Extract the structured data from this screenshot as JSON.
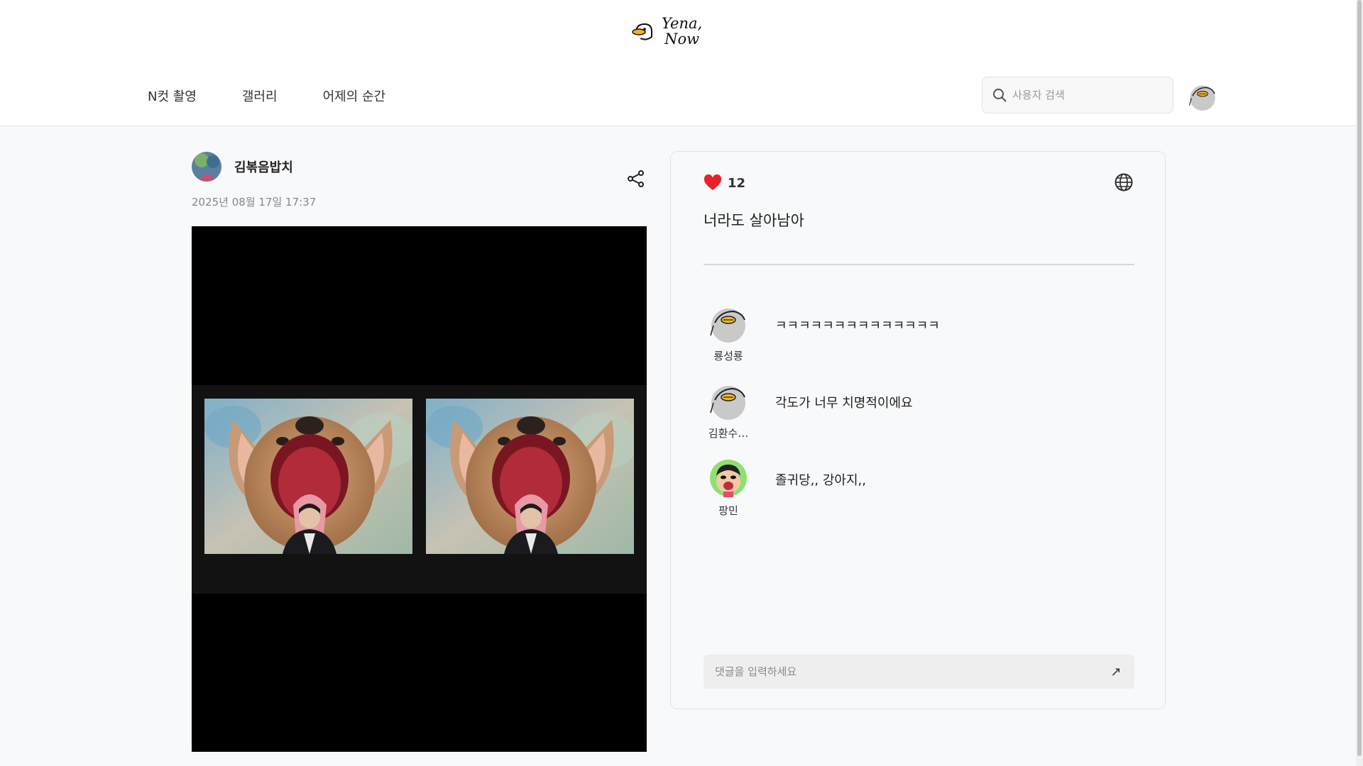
{
  "header": {
    "logo_line1": "Yena,",
    "logo_line2": "Now",
    "nav": [
      {
        "label": "N컷 촬영"
      },
      {
        "label": "갤러리"
      },
      {
        "label": "어제의 순간"
      }
    ],
    "search": {
      "placeholder": "사용자 검색",
      "icon": "search-icon"
    },
    "profile_icon": "duck-avatar-icon"
  },
  "post": {
    "author": "김볶음밥치",
    "date": "2025년 08월 17일 17:37",
    "share_icon": "share-icon",
    "photo_frames": 2
  },
  "details": {
    "likes": "12",
    "like_color": "#e8202a",
    "visibility_icon": "globe-icon",
    "caption": "너라도 살아남아",
    "comments": [
      {
        "user": "룡성룡",
        "text": "ㅋㅋㅋㅋㅋㅋㅋㅋㅋㅋㅋㅋㅋㅋ",
        "avatar": "duck-avatar"
      },
      {
        "user": "김환수…",
        "text": "각도가 너무 치명적이에요",
        "avatar": "duck-avatar"
      },
      {
        "user": "팡민",
        "text": "졸귀당,, 강아지,,",
        "avatar": "cartoon-avatar"
      }
    ],
    "comment_input": {
      "placeholder": "댓글을 입력하세요",
      "send_icon": "send-arrow-icon"
    }
  }
}
